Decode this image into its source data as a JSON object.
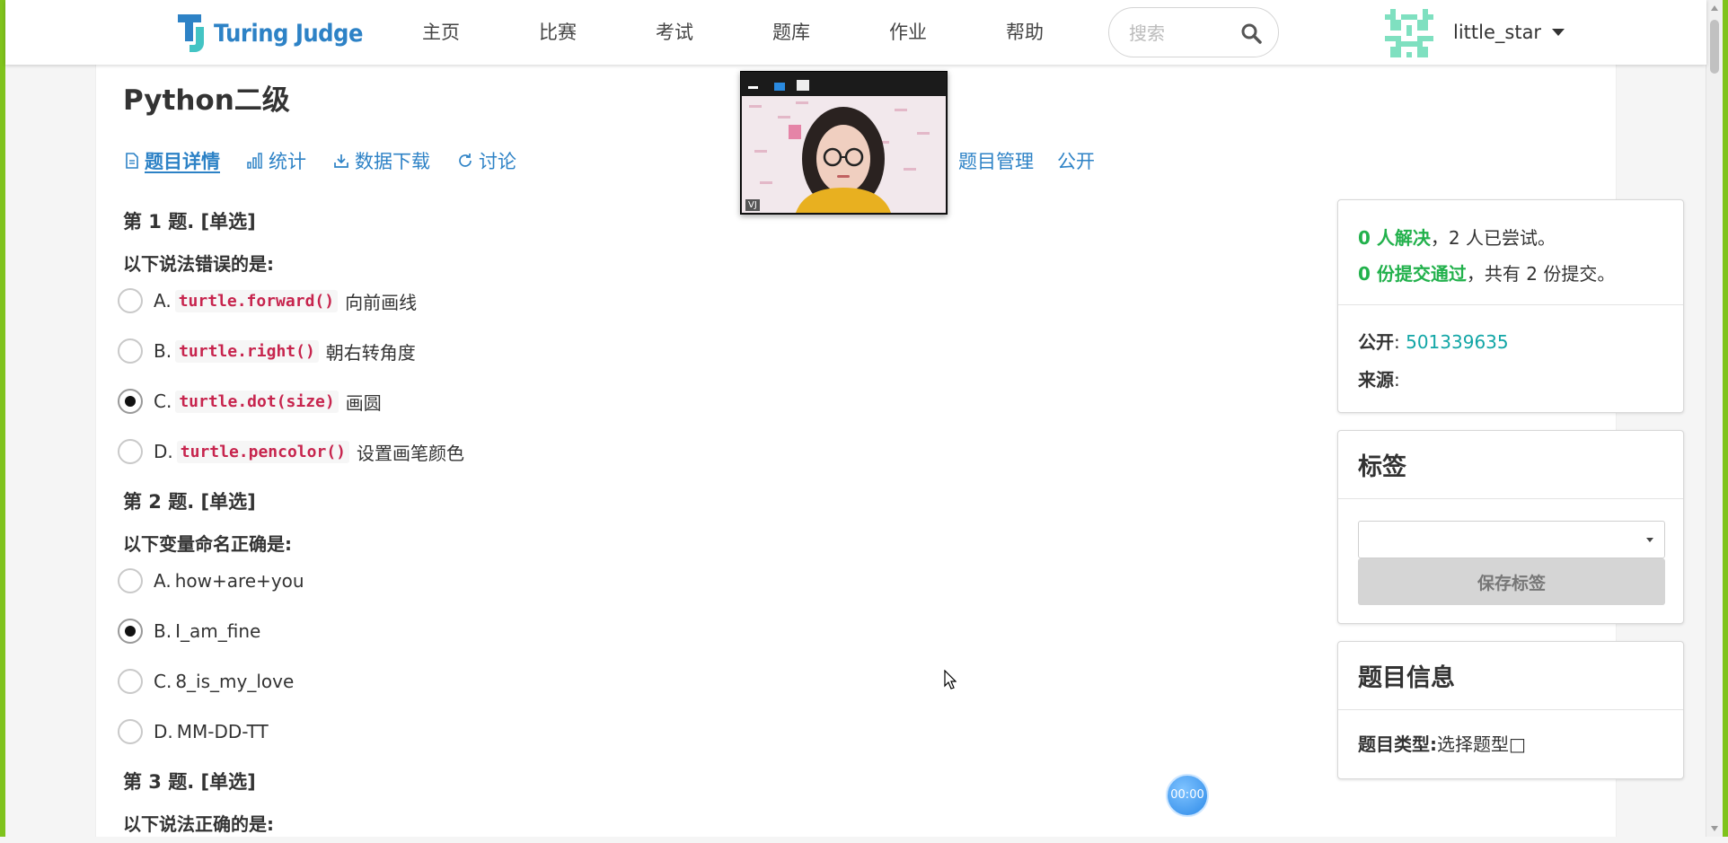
{
  "header": {
    "logo_text": "Turing Judge",
    "nav": [
      "主页",
      "比赛",
      "考试",
      "题库",
      "作业",
      "帮助"
    ],
    "search_placeholder": "搜索",
    "username": "little_star"
  },
  "page": {
    "title": "Python二级",
    "tabs": [
      {
        "label": "题目详情",
        "icon": "document-icon"
      },
      {
        "label": "统计",
        "icon": "bar-chart-icon"
      },
      {
        "label": "数据下载",
        "icon": "download-icon"
      },
      {
        "label": "讨论",
        "icon": "refresh-icon"
      }
    ],
    "tabs_right": [
      "题目管理",
      "公开"
    ]
  },
  "questions": [
    {
      "head": "第 1 题. [单选]",
      "prompt": "以下说法错误的是:",
      "options": [
        {
          "letter": "A.",
          "code": "turtle.forward()",
          "text": "向前画线",
          "checked": false
        },
        {
          "letter": "B.",
          "code": "turtle.right()",
          "text": "朝右转角度",
          "checked": false
        },
        {
          "letter": "C.",
          "code": "turtle.dot(size)",
          "text": "画圆",
          "checked": true
        },
        {
          "letter": "D.",
          "code": "turtle.pencolor()",
          "text": "设置画笔颜色",
          "checked": false
        }
      ]
    },
    {
      "head": "第 2 题. [单选]",
      "prompt": "以下变量命名正确是:",
      "options": [
        {
          "letter": "A.",
          "text": "how+are+you",
          "checked": false
        },
        {
          "letter": "B.",
          "text": "I_am_fine",
          "checked": true
        },
        {
          "letter": "C.",
          "text": "8_is_my_love",
          "checked": false
        },
        {
          "letter": "D.",
          "text": "MM-DD-TT",
          "checked": false
        }
      ]
    },
    {
      "head": "第 3 题. [单选]",
      "prompt": "以下说法正确的是:"
    }
  ],
  "stats": {
    "solved": "0 人解决",
    "tried": "，2 人已尝试。",
    "accepted": "0 份提交通过",
    "submissions": "，共有 2 份提交。",
    "public_label": "公开",
    "public_value": "501339635",
    "source_label": "来源"
  },
  "tags_panel": {
    "title": "标签",
    "save_label": "保存标签"
  },
  "info_panel": {
    "title": "题目信息",
    "type_label": "题目类型:",
    "type_value": "选择题型□"
  },
  "video": {
    "badge": "VJ"
  },
  "timer": "00:00",
  "colors": {
    "accent": "#2d82c6",
    "success": "#22b14c",
    "teal": "#12a6a6",
    "code": "#c7254e",
    "frame": "#7fc31c"
  }
}
